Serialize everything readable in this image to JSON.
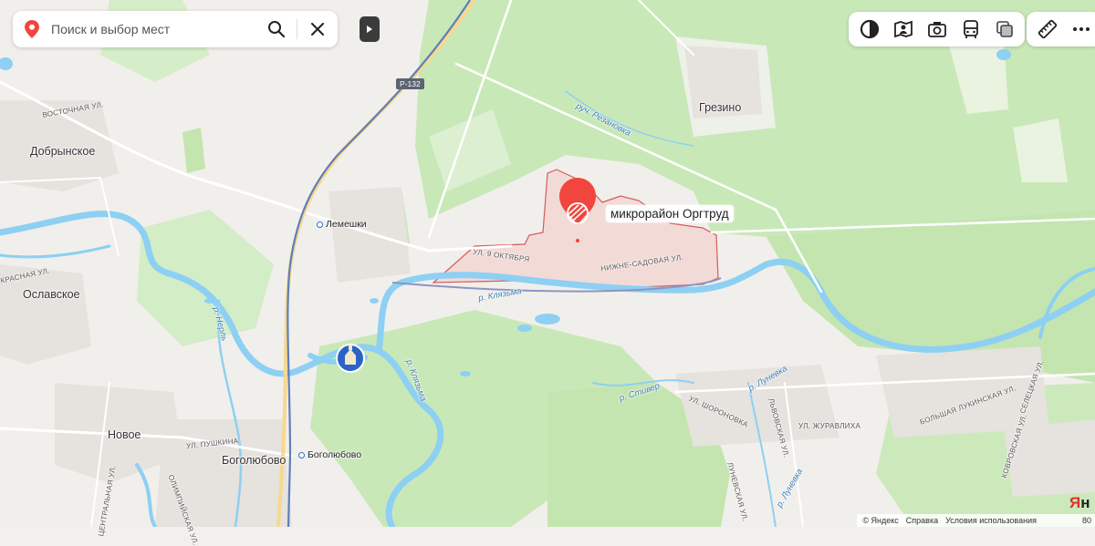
{
  "search": {
    "placeholder": "Поиск и выбор мест"
  },
  "selected_place": {
    "name": "микрорайон Оргтруд"
  },
  "toolbar": {
    "layers": [
      "layers-icon",
      "panorama-icon",
      "camera-icon",
      "transport-icon",
      "layer-stack-icon"
    ],
    "tools": [
      "ruler-icon",
      "more-icon"
    ]
  },
  "road_badges": [
    "Р-132"
  ],
  "settlements": [
    "Грезино",
    "Добрынское",
    "Ославское",
    "Новое",
    "Боголюбово"
  ],
  "stations": [
    "Лемешки",
    "Боголюбово"
  ],
  "streets": {
    "vostochnaya": "Восточная ул.",
    "krasnaya": "Красная ул.",
    "oktyabrya": "ул. 9 Октября",
    "nizhne_sadovaya": "Нижне-Садовая ул.",
    "pushkina": "ул. Пушкина",
    "tsentralnaya": "Центральная ул.",
    "olimpiyskaya": "Олимпийская ул.",
    "shoronovka": "ул. Шороновка",
    "lvovskaya": "Львовская ул.",
    "zhuravlikha": "ул. Журавлиха",
    "bolshaya_lukinskaya": "Большая Лукинская ул.",
    "kovrovskaya": "Ковровская ул.",
    "seletskaya": "Селецкая ул.",
    "lunevskaya": "Луневская ул."
  },
  "rivers": {
    "rezanovka": "руч. Резановка",
    "klyazma_1": "р. Клязьма",
    "klyazma_2": "р. Клязьма",
    "nerl": "р. Нерль",
    "stiver": "р. Стивер",
    "lunevka_1": "р. Луневка",
    "lunevka_2": "р. Луневка"
  },
  "attribution": {
    "copyright": "© Яндекс",
    "help": "Справка",
    "terms": "Условия использования",
    "scale": "80"
  },
  "logo_text": "Ян",
  "colors": {
    "forest": "#c9e8b8",
    "forest_dark": "#bde0a9",
    "water": "#8dd0f3",
    "urban": "#e7e3df",
    "district_fill": "#f2d6d4",
    "district_border": "#d45b5b",
    "marker": "#f2453d",
    "rail": "#5e7fb8"
  }
}
